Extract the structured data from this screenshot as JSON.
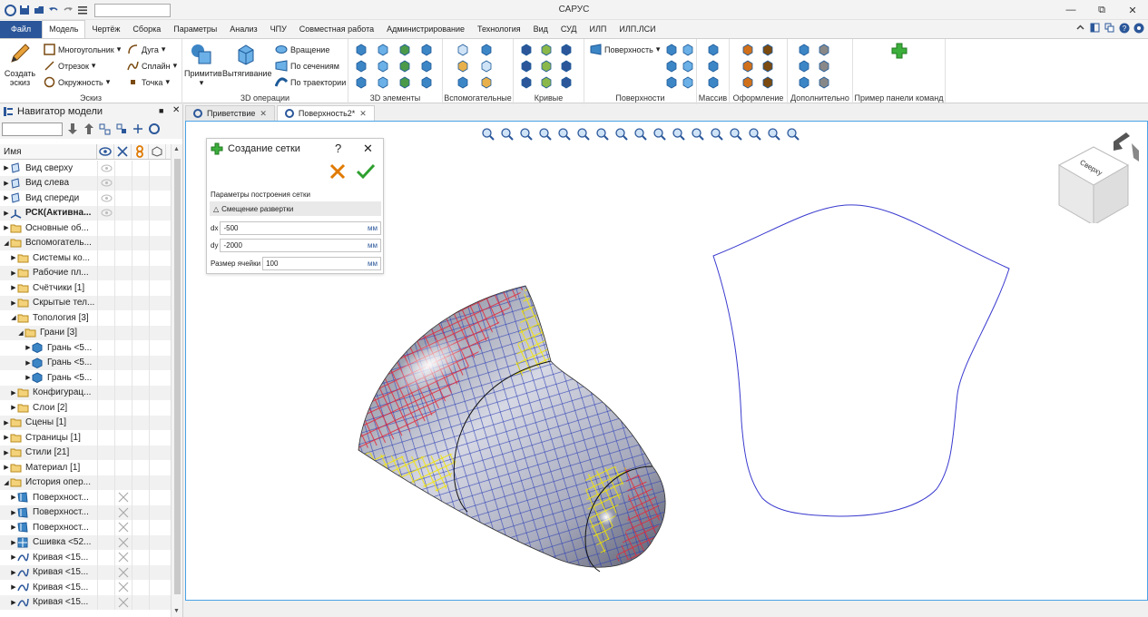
{
  "app": {
    "title": "САРУС"
  },
  "tabs": [
    {
      "label": "Файл"
    },
    {
      "label": "Модель"
    },
    {
      "label": "Чертёж"
    },
    {
      "label": "Сборка"
    },
    {
      "label": "Параметры"
    },
    {
      "label": "Анализ"
    },
    {
      "label": "ЧПУ"
    },
    {
      "label": "Совместная работа"
    },
    {
      "label": "Администрирование"
    },
    {
      "label": "Технология"
    },
    {
      "label": "Вид"
    },
    {
      "label": "СУД"
    },
    {
      "label": "ИЛП"
    },
    {
      "label": "ИЛП.ЛСИ"
    }
  ],
  "ribbon": {
    "sketch": {
      "create": "Создать эскиз",
      "polygon": "Многоугольник",
      "segment": "Отрезок",
      "circle": "Окружность",
      "arc": "Дуга",
      "spline": "Сплайн",
      "point": "Точка",
      "label": "Эскиз"
    },
    "ops3d": {
      "primitive": "Примитив",
      "extrude": "Вытягивание",
      "rotate": "Вращение",
      "sections": "По сечениям",
      "path": "По траектории",
      "label": "3D операции"
    },
    "labels": {
      "elements3d": "3D элементы",
      "aux": "Вспомогательные",
      "curves": "Кривые",
      "surfaces": "Поверхности",
      "surface_btn": "Поверхность",
      "array": "Массив",
      "design": "Оформление",
      "extra": "Дополнительно",
      "example": "Пример панели команд"
    }
  },
  "navigator": {
    "title": "Навигатор модели",
    "col_name": "Имя",
    "items": [
      {
        "label": "Вид сверху",
        "level": 0,
        "icon": "plane",
        "eye": true
      },
      {
        "label": "Вид слева",
        "level": 0,
        "icon": "plane",
        "eye": true
      },
      {
        "label": "Вид спереди",
        "level": 0,
        "icon": "plane",
        "eye": true
      },
      {
        "label": "РСК(Активна...",
        "level": 0,
        "icon": "axes",
        "eye": true,
        "bold": true
      },
      {
        "label": "Основные об...",
        "level": 0,
        "icon": "folder"
      },
      {
        "label": "Вспомогатель...",
        "level": 0,
        "icon": "folder",
        "open": true
      },
      {
        "label": "Системы ко...",
        "level": 1,
        "icon": "folder"
      },
      {
        "label": "Рабочие пл...",
        "level": 1,
        "icon": "folder"
      },
      {
        "label": "Счётчики [1]",
        "level": 1,
        "icon": "folder"
      },
      {
        "label": "Скрытые тел...",
        "level": 1,
        "icon": "folder"
      },
      {
        "label": "Топология [3]",
        "level": 1,
        "icon": "folder",
        "open": true
      },
      {
        "label": "Грани [3]",
        "level": 2,
        "icon": "folder",
        "open": true
      },
      {
        "label": "Грань <5...",
        "level": 3,
        "icon": "cube"
      },
      {
        "label": "Грань <5...",
        "level": 3,
        "icon": "cube"
      },
      {
        "label": "Грань <5...",
        "level": 3,
        "icon": "cube"
      },
      {
        "label": "Конфигурац...",
        "level": 1,
        "icon": "folder"
      },
      {
        "label": "Слои [2]",
        "level": 1,
        "icon": "folder"
      },
      {
        "label": "Сцены [1]",
        "level": 0,
        "icon": "folder"
      },
      {
        "label": "Страницы [1]",
        "level": 0,
        "icon": "folder"
      },
      {
        "label": "Стили [21]",
        "level": 0,
        "icon": "folder"
      },
      {
        "label": "Материал [1]",
        "level": 0,
        "icon": "folder"
      },
      {
        "label": "История опер...",
        "level": 0,
        "icon": "folder",
        "open": true
      },
      {
        "label": "Поверхност...",
        "level": 1,
        "icon": "surface",
        "x": true
      },
      {
        "label": "Поверхност...",
        "level": 1,
        "icon": "surface",
        "x": true
      },
      {
        "label": "Поверхност...",
        "level": 1,
        "icon": "surface",
        "x": true
      },
      {
        "label": "Сшивка <52...",
        "level": 1,
        "icon": "stitch",
        "x": true
      },
      {
        "label": "Кривая <15...",
        "level": 1,
        "icon": "curve",
        "x": true
      },
      {
        "label": "Кривая <15...",
        "level": 1,
        "icon": "curve",
        "x": true
      },
      {
        "label": "Кривая <15...",
        "level": 1,
        "icon": "curve",
        "x": true
      },
      {
        "label": "Кривая <15...",
        "level": 1,
        "icon": "curve",
        "x": true
      }
    ]
  },
  "doc_tabs": [
    {
      "label": "Приветствие",
      "active": false
    },
    {
      "label": "Поверхность2*",
      "active": true
    }
  ],
  "dialog": {
    "title": "Создание сетки",
    "section": "Параметры построения сетки",
    "subsection": "Смещение развертки",
    "dx_label": "dx",
    "dx_value": "-500",
    "dy_label": "dy",
    "dy_value": "-2000",
    "cell_label": "Размер ячейки",
    "cell_value": "100",
    "unit": "мм"
  },
  "viewcube": {
    "top": "Сверху"
  },
  "colors": {
    "accent": "#2b579a",
    "viewport_border": "#4aa3e8",
    "mesh_blue": "#2c3fb5",
    "mesh_red": "#e0283a",
    "mesh_yellow": "#f2e400",
    "outline": "#3a3acf"
  }
}
